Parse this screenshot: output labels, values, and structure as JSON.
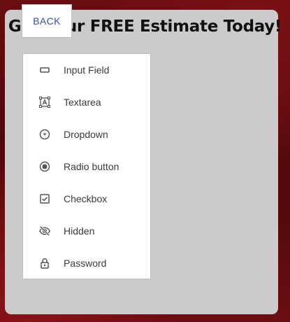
{
  "form": {
    "title": "Get Your FREE Estimate Today!"
  },
  "toolbar": {
    "back_label": "BACK"
  },
  "menu": {
    "items": [
      {
        "label": "Input Field",
        "icon": "input-field-icon"
      },
      {
        "label": "Textarea",
        "icon": "textarea-icon"
      },
      {
        "label": "Dropdown",
        "icon": "dropdown-icon"
      },
      {
        "label": "Radio button",
        "icon": "radio-button-icon"
      },
      {
        "label": "Checkbox",
        "icon": "checkbox-icon"
      },
      {
        "label": "Hidden",
        "icon": "hidden-icon"
      },
      {
        "label": "Password",
        "icon": "lock-icon"
      }
    ]
  },
  "colors": {
    "panel_bg": "#cbcbcb",
    "back_text": "#3d4fa3",
    "item_text": "#3a3a3a",
    "icon_color": "#555555"
  }
}
